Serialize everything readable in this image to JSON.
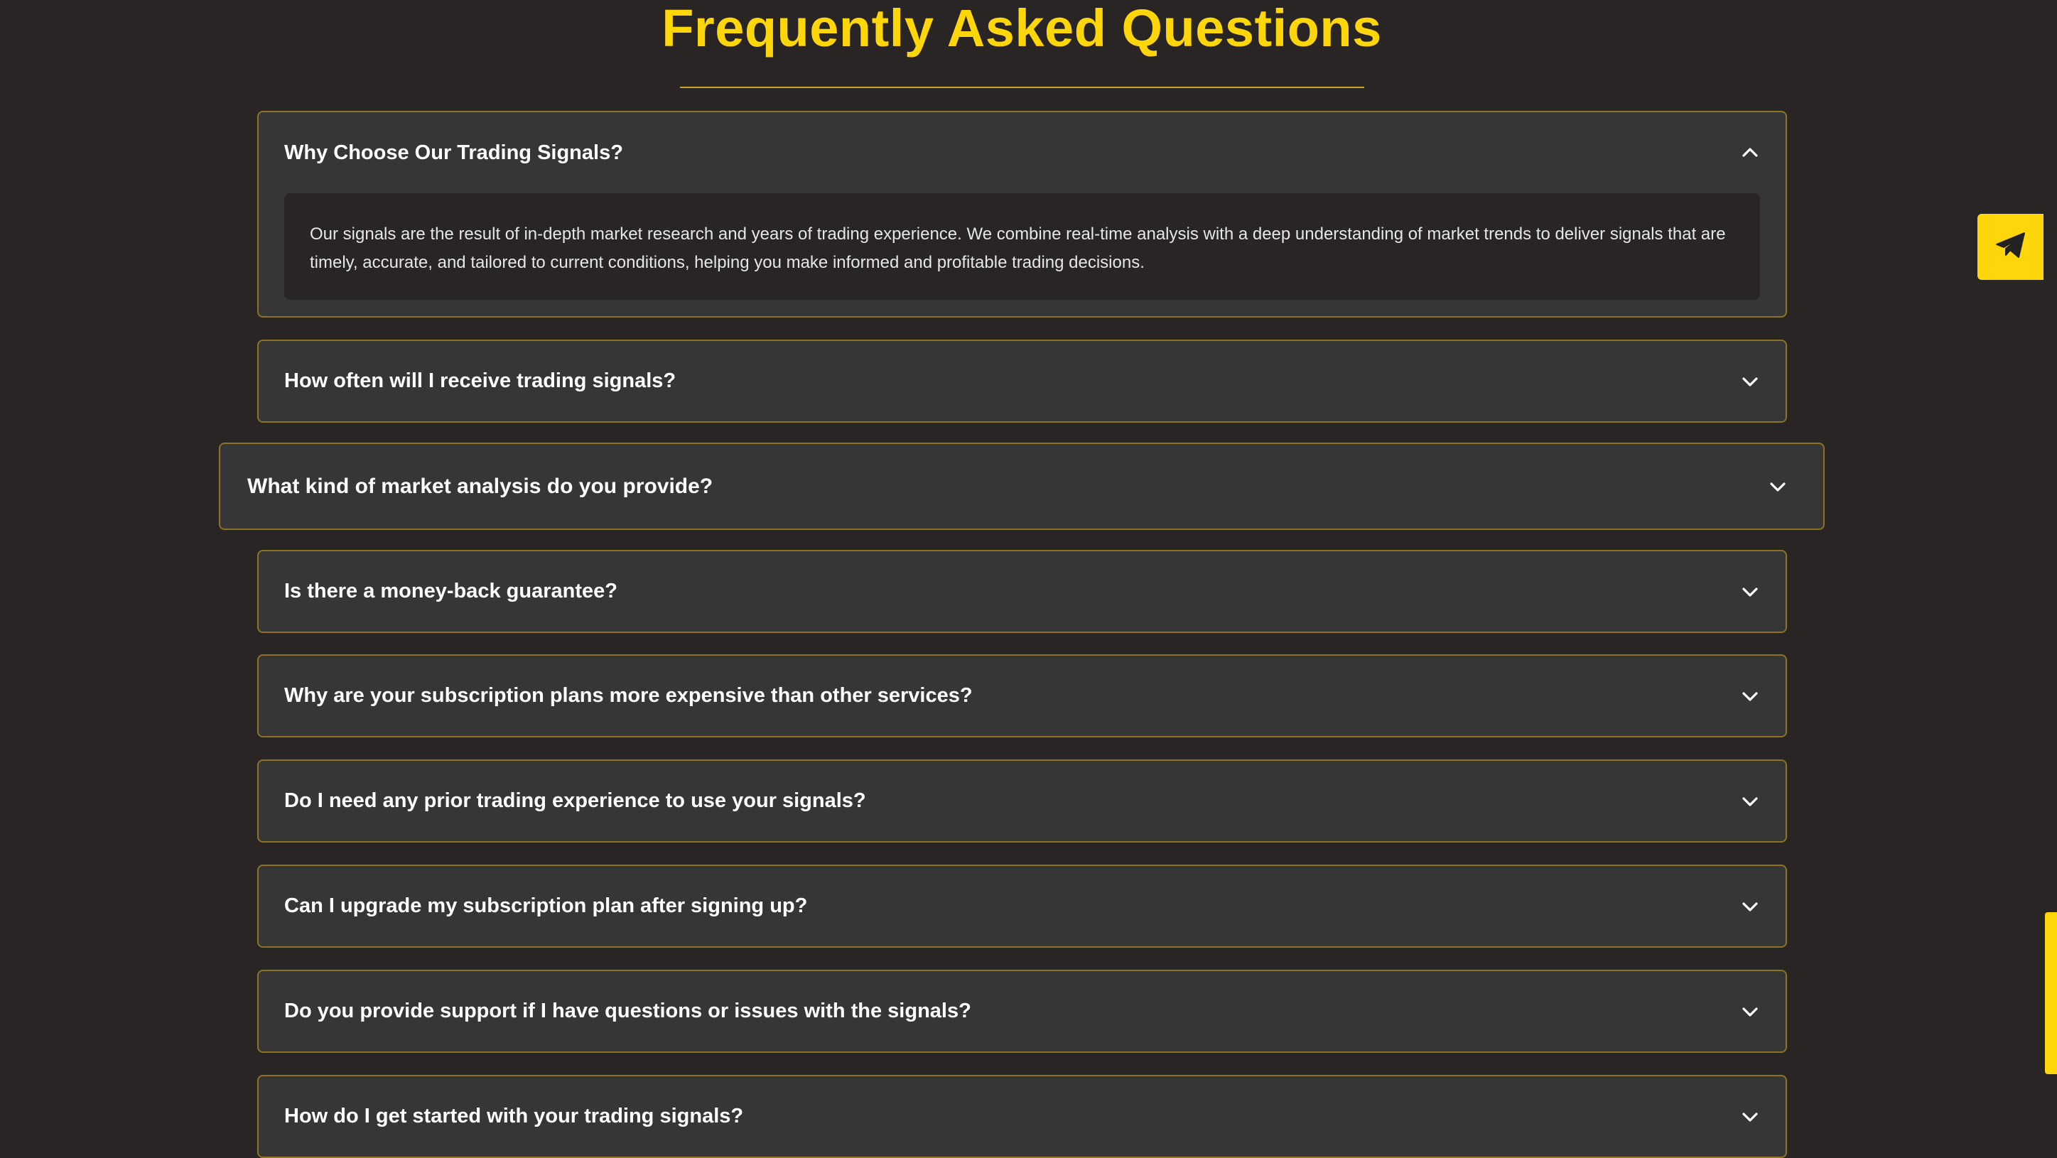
{
  "page": {
    "title": "Frequently Asked Questions"
  },
  "colors": {
    "background": "#292524",
    "accent": "#ffd60a",
    "card": "#363636",
    "card_border": "#8c7424",
    "text": "#ffffff"
  },
  "faq": {
    "items": [
      {
        "question": "Why Choose Our Trading Signals?",
        "expanded": true,
        "icon": "chevron-up-icon",
        "answer": "Our signals are the result of in-depth market research and years of trading experience. We combine real-time analysis with a deep understanding of market trends to deliver signals that are timely, accurate, and tailored to current conditions, helping you make informed and profitable trading decisions."
      },
      {
        "question": "How often will I receive trading signals?",
        "expanded": false,
        "icon": "chevron-down-icon"
      },
      {
        "question": "What kind of market analysis do you provide?",
        "expanded": false,
        "icon": "chevron-down-icon"
      },
      {
        "question": "Is there a money-back guarantee?",
        "expanded": false,
        "icon": "chevron-down-icon"
      },
      {
        "question": "Why are your subscription plans more expensive than other services?",
        "expanded": false,
        "icon": "chevron-down-icon"
      },
      {
        "question": "Do I need any prior trading experience to use your signals?",
        "expanded": false,
        "icon": "chevron-down-icon"
      },
      {
        "question": "Can I upgrade my subscription plan after signing up?",
        "expanded": false,
        "icon": "chevron-down-icon"
      },
      {
        "question": "Do you provide support if I have questions or issues with the signals?",
        "expanded": false,
        "icon": "chevron-down-icon"
      },
      {
        "question": "How do I get started with your trading signals?",
        "expanded": false,
        "icon": "chevron-down-icon"
      }
    ]
  },
  "fab": {
    "icon": "telegram-send-icon"
  }
}
